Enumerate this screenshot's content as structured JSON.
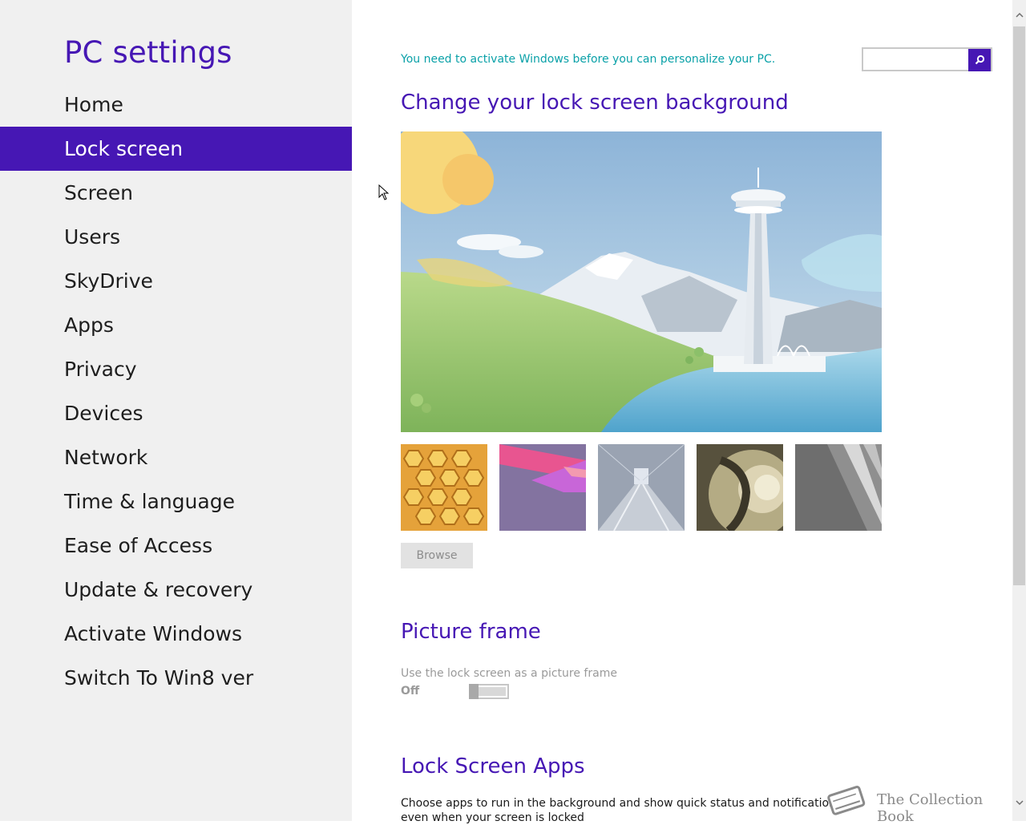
{
  "sidebar": {
    "title": "PC settings",
    "items": [
      {
        "label": "Home"
      },
      {
        "label": "Lock screen",
        "selected": true
      },
      {
        "label": "Screen"
      },
      {
        "label": "Users"
      },
      {
        "label": "SkyDrive"
      },
      {
        "label": "Apps"
      },
      {
        "label": "Privacy"
      },
      {
        "label": "Devices"
      },
      {
        "label": "Network"
      },
      {
        "label": "Time & language"
      },
      {
        "label": "Ease of Access"
      },
      {
        "label": "Update & recovery"
      },
      {
        "label": "Activate Windows"
      },
      {
        "label": "Switch To Win8 ver"
      }
    ]
  },
  "main": {
    "activation_notice": "You need to activate Windows before you can personalize your PC.",
    "search": {
      "placeholder": "",
      "icon": "search-icon"
    },
    "lock_background": {
      "title": "Change your lock screen background",
      "thumbnails": [
        "honeycomb",
        "purple-geometric",
        "train-tunnel",
        "nautilus-shell",
        "piano-keys"
      ],
      "browse_label": "Browse"
    },
    "picture_frame": {
      "title": "Picture frame",
      "description": "Use the lock screen as a picture frame",
      "toggle_state": "Off",
      "toggle_on": false
    },
    "lock_apps": {
      "title": "Lock Screen Apps",
      "description": "Choose apps to run in the background and show quick status and notifications, even when your screen is locked"
    }
  },
  "watermark": {
    "text": "The Collection Book",
    "icon": "book-icon"
  },
  "colors": {
    "accent": "#4617b4",
    "notice": "#0aa1a8",
    "sidebar_bg": "#f0f0f0"
  }
}
